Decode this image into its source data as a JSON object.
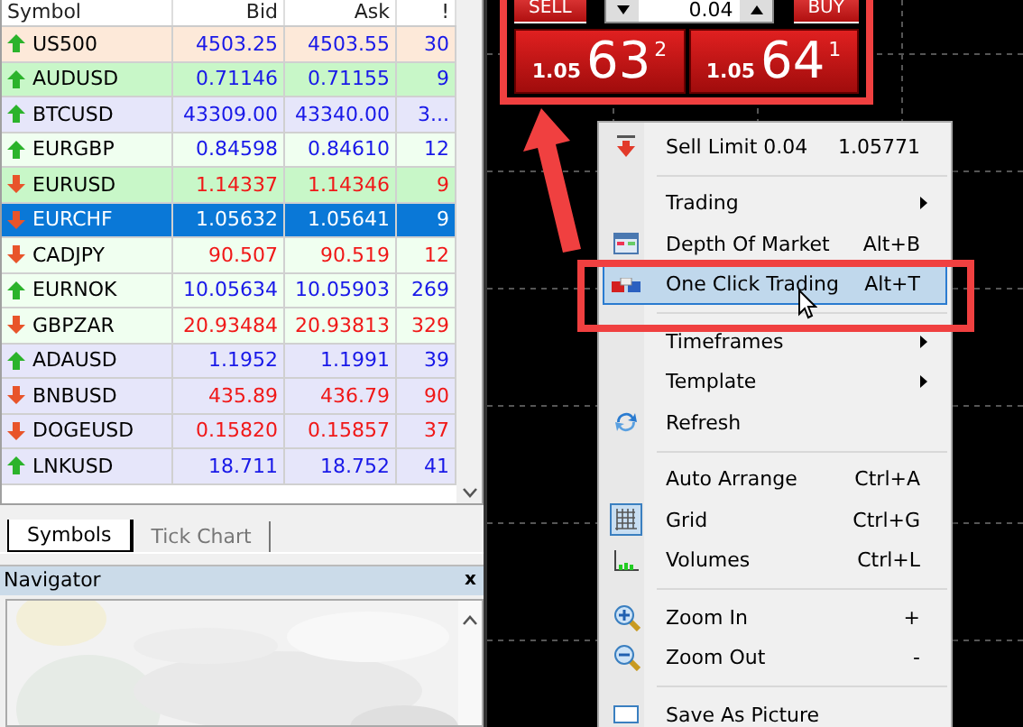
{
  "market_watch": {
    "columns": [
      "Symbol",
      "Bid",
      "Ask",
      "!"
    ],
    "rows": [
      {
        "symbol": "US500",
        "bid": "4503.25",
        "ask": "4503.55",
        "spread": "30",
        "kind": "up",
        "color": "#fde9d9",
        "selected": false
      },
      {
        "symbol": "AUDUSD",
        "bid": "0.71146",
        "ask": "0.71155",
        "spread": "9",
        "kind": "up",
        "color": "#c8f7c8",
        "selected": false
      },
      {
        "symbol": "BTCUSD",
        "bid": "43309.00",
        "ask": "43340.00",
        "spread": "3...",
        "kind": "up",
        "color": "#e6e6fa",
        "selected": false
      },
      {
        "symbol": "EURGBP",
        "bid": "0.84598",
        "ask": "0.84610",
        "spread": "12",
        "kind": "up",
        "color": "#f0fff0",
        "selected": false
      },
      {
        "symbol": "EURUSD",
        "bid": "1.14337",
        "ask": "1.14346",
        "spread": "9",
        "kind": "down",
        "color": "#c8f7c8",
        "selected": false
      },
      {
        "symbol": "EURCHF",
        "bid": "1.05632",
        "ask": "1.05641",
        "spread": "9",
        "kind": "down",
        "color": "#0a78d7",
        "selected": true
      },
      {
        "symbol": "CADJPY",
        "bid": "90.507",
        "ask": "90.519",
        "spread": "12",
        "kind": "down",
        "color": "#f0fff0",
        "selected": false
      },
      {
        "symbol": "EURNOK",
        "bid": "10.05634",
        "ask": "10.05903",
        "spread": "269",
        "kind": "up",
        "color": "#f0fff0",
        "selected": false
      },
      {
        "symbol": "GBPZAR",
        "bid": "20.93484",
        "ask": "20.93813",
        "spread": "329",
        "kind": "down",
        "color": "#f0fff0",
        "selected": false
      },
      {
        "symbol": "ADAUSD",
        "bid": "1.1952",
        "ask": "1.1991",
        "spread": "39",
        "kind": "up",
        "color": "#e6e6fa",
        "selected": false
      },
      {
        "symbol": "BNBUSD",
        "bid": "435.89",
        "ask": "436.79",
        "spread": "90",
        "kind": "down",
        "color": "#e6e6fa",
        "selected": false
      },
      {
        "symbol": "DOGEUSD",
        "bid": "0.15820",
        "ask": "0.15857",
        "spread": "37",
        "kind": "down",
        "color": "#e6e6fa",
        "selected": false
      },
      {
        "symbol": "LNKUSD",
        "bid": "18.711",
        "ask": "18.752",
        "spread": "41",
        "kind": "up",
        "color": "#e6e6fa",
        "selected": false
      }
    ],
    "tabs": [
      {
        "label": "Symbols",
        "selected": true
      },
      {
        "label": "Tick Chart",
        "selected": false
      }
    ]
  },
  "navigator": {
    "title": "Navigator",
    "close": "x"
  },
  "one_click": {
    "sell_label": "SELL",
    "buy_label": "BUY",
    "lot": "0.04",
    "sell": {
      "prefix": "1.05",
      "big": "63",
      "sup": "2"
    },
    "buy": {
      "prefix": "1.05",
      "big": "64",
      "sup": "1"
    }
  },
  "context_menu": [
    {
      "kind": "item",
      "label": "Sell Limit 0.04",
      "shortcut": "1.05771",
      "selected": false
    },
    {
      "kind": "separator"
    },
    {
      "kind": "item",
      "label": "Trading",
      "submenu": true,
      "selected": false
    },
    {
      "kind": "item",
      "label": "Depth Of Market",
      "shortcut": "Alt+B",
      "selected": false
    },
    {
      "kind": "item",
      "label": "One Click Trading",
      "shortcut": "Alt+T",
      "selected": true
    },
    {
      "kind": "separator"
    },
    {
      "kind": "item",
      "label": "Timeframes",
      "submenu": true,
      "selected": false
    },
    {
      "kind": "item",
      "label": "Template",
      "submenu": true,
      "selected": false
    },
    {
      "kind": "item",
      "label": "Refresh",
      "selected": false
    },
    {
      "kind": "separator"
    },
    {
      "kind": "item",
      "label": "Auto Arrange",
      "shortcut": "Ctrl+A",
      "checked": false,
      "selected": false
    },
    {
      "kind": "item",
      "label": "Grid",
      "shortcut": "Ctrl+G",
      "checked": true,
      "selected": false
    },
    {
      "kind": "item",
      "label": "Volumes",
      "shortcut": "Ctrl+L",
      "checked": false,
      "selected": false
    },
    {
      "kind": "separator"
    },
    {
      "kind": "item",
      "label": "Zoom In",
      "shortcut": "+",
      "selected": false
    },
    {
      "kind": "item",
      "label": "Zoom Out",
      "shortcut": "-",
      "selected": false
    },
    {
      "kind": "separator"
    },
    {
      "kind": "item",
      "label": "Save As Picture",
      "selected": false
    }
  ]
}
